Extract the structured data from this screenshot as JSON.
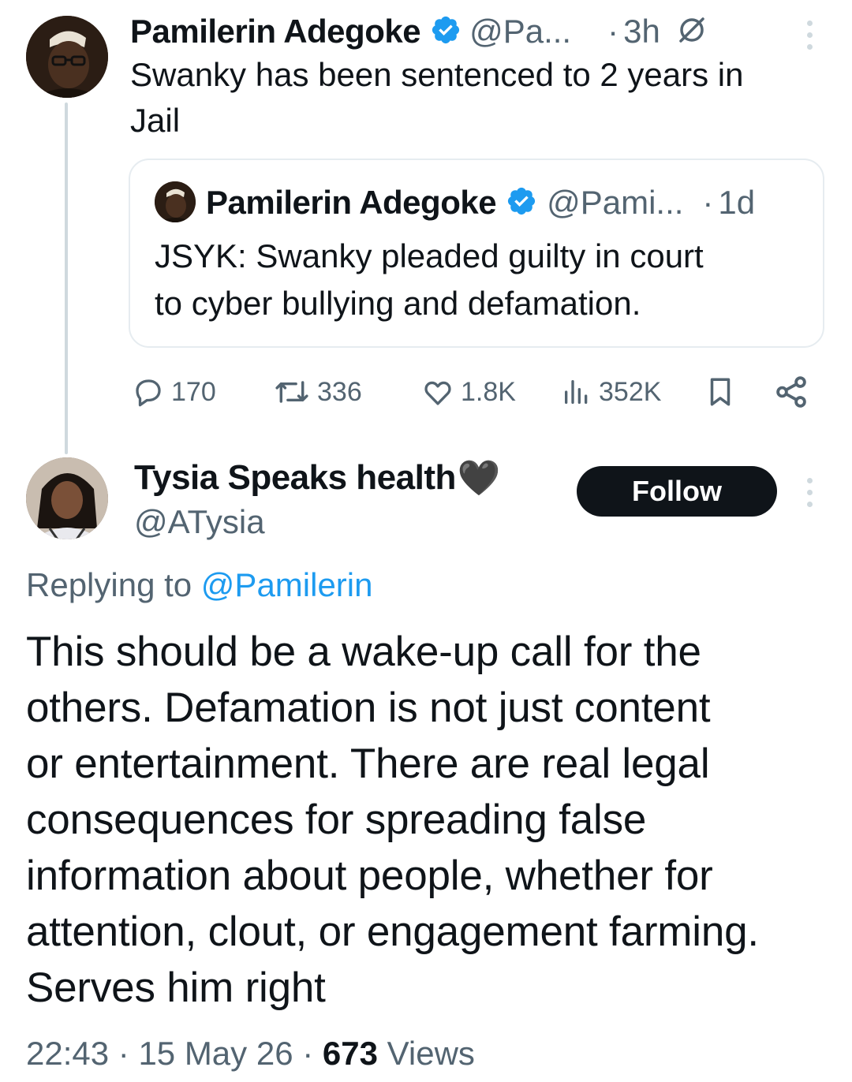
{
  "original_tweet": {
    "author_name": "Pamilerin Adegoke",
    "handle": "@Pa...",
    "time": "3h",
    "text_line1": "Swanky has been sentenced to 2 years in",
    "text_line2": "Jail"
  },
  "quoted_tweet": {
    "author_name": "Pamilerin Adegoke",
    "handle": "@Pami...",
    "time": "1d",
    "text_line1": "JSYK: Swanky pleaded guilty in court",
    "text_line2": "to cyber bullying and defamation."
  },
  "actions": {
    "replies": "170",
    "reposts": "336",
    "likes": "1.8K",
    "views": "352K"
  },
  "reply": {
    "author_name": "Tysia Speaks health",
    "author_emoji": "🖤",
    "handle": "@ATysia",
    "follow_label": "Follow",
    "replying_prefix": "Replying to",
    "replying_to": "@Pamilerin",
    "lines": [
      "This should be a wake-up call for the",
      "others. Defamation is not just content",
      "or entertainment. There are real legal",
      "consequences for spreading false",
      "information about people, whether for",
      "attention, clout, or engagement farming.",
      "Serves him right"
    ],
    "time": "22:43",
    "date": "15 May 26",
    "views_count": "673",
    "views_label": "Views"
  },
  "colors": {
    "accent": "#1d9bf0",
    "text": "#0f1419",
    "muted": "#536471",
    "border": "#e6ecf0"
  },
  "icons": [
    "verified-badge-icon",
    "grok-slash-icon",
    "more-options-icon",
    "reply-icon",
    "repost-icon",
    "like-icon",
    "views-icon",
    "bookmark-icon",
    "share-icon",
    "black-heart-emoji"
  ]
}
